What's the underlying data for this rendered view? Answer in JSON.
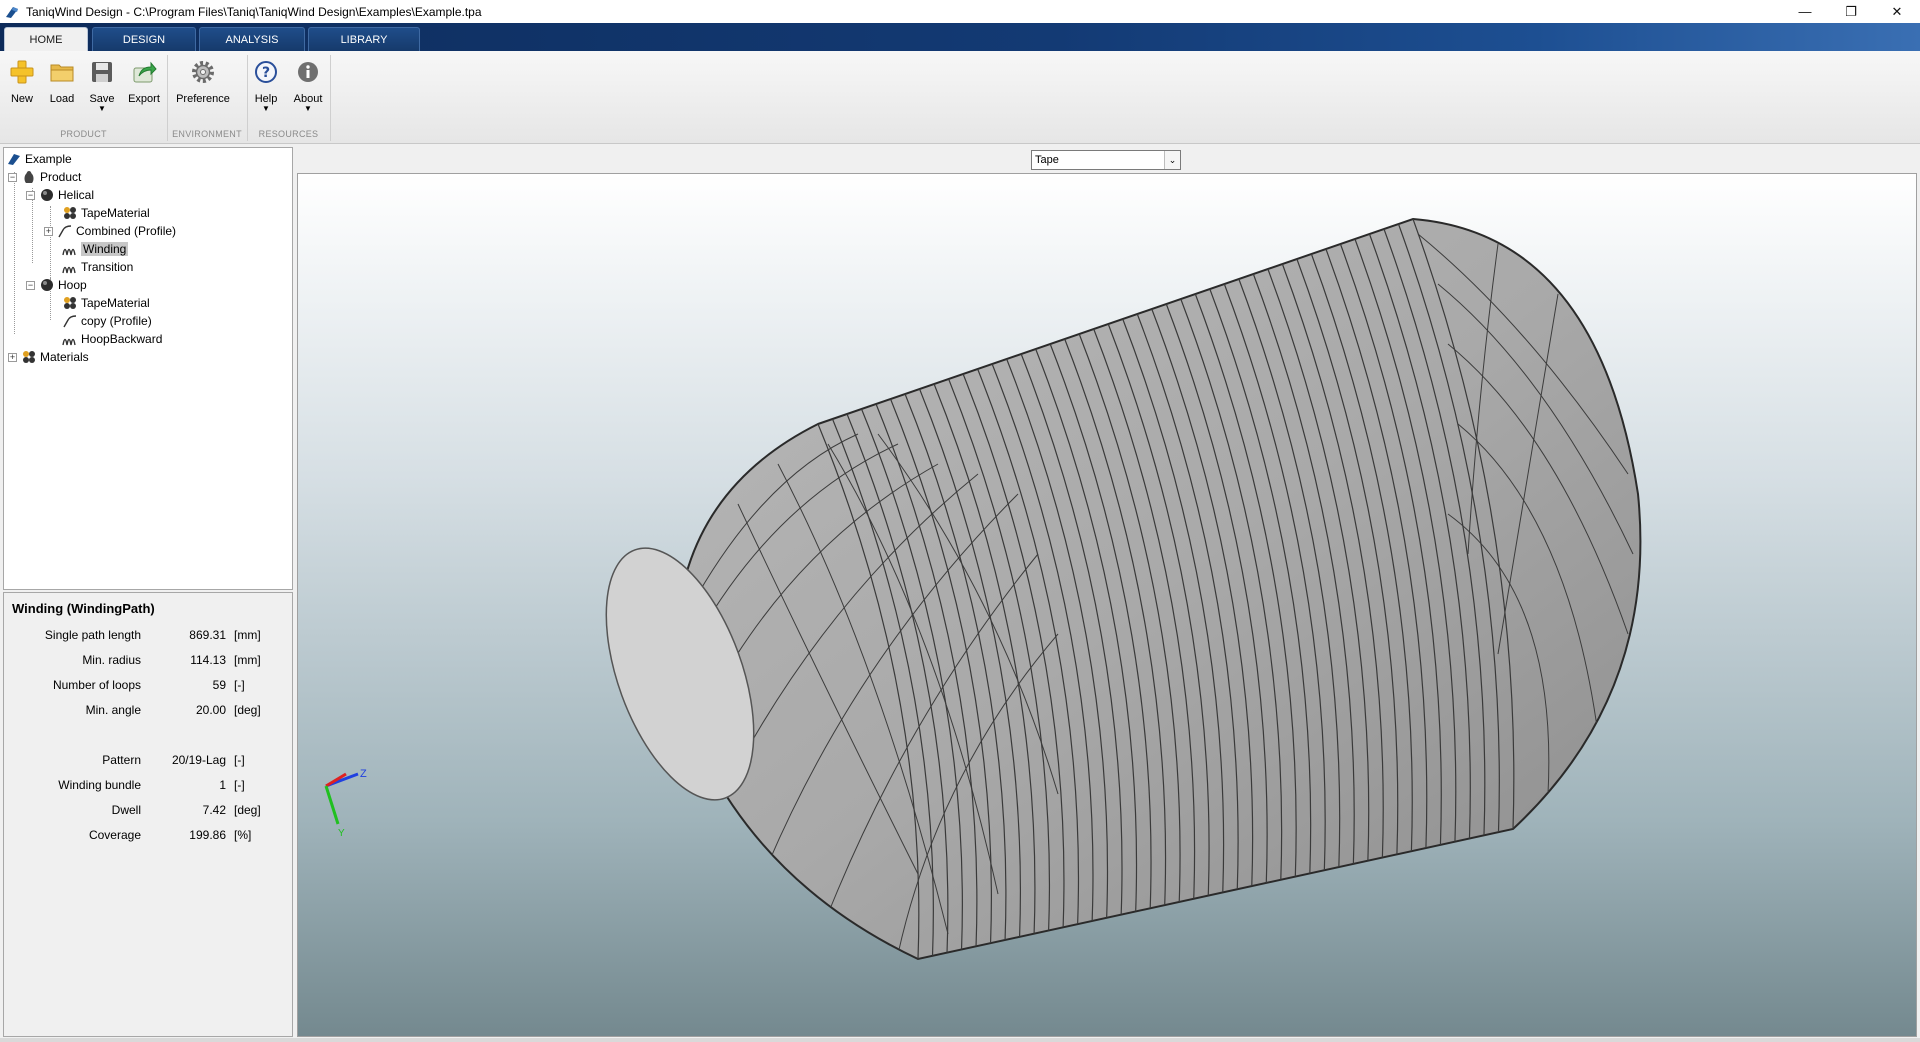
{
  "window": {
    "title": "TaniqWind Design - C:\\Program Files\\Taniq\\TaniqWind Design\\Examples\\Example.tpa",
    "controls": [
      "minimize",
      "restore",
      "close"
    ]
  },
  "tabs": [
    {
      "label": "HOME",
      "active": true
    },
    {
      "label": "DESIGN",
      "active": false
    },
    {
      "label": "ANALYSIS",
      "active": false
    },
    {
      "label": "LIBRARY",
      "active": false
    }
  ],
  "ribbon": {
    "buttons": {
      "new": "New",
      "load": "Load",
      "save": "Save",
      "export": "Export",
      "preference": "Preference",
      "help": "Help",
      "about": "About"
    },
    "groups": {
      "product": "PRODUCT",
      "environment": "ENVIRONMENT",
      "resources": "RESOURCES"
    }
  },
  "tree": {
    "root": "Example",
    "product": "Product",
    "helical": "Helical",
    "helical_tape": "TapeMaterial",
    "helical_profile": "Combined (Profile)",
    "helical_winding": "Winding",
    "helical_transition": "Transition",
    "hoop": "Hoop",
    "hoop_tape": "TapeMaterial",
    "hoop_profile": "copy (Profile)",
    "hoop_backward": "HoopBackward",
    "materials": "Materials",
    "selected": "Winding"
  },
  "properties": {
    "title": "Winding (WindingPath)",
    "rows": [
      {
        "label": "Single path length",
        "value": "869.31",
        "unit": "[mm]"
      },
      {
        "label": "Min. radius",
        "value": "114.13",
        "unit": "[mm]"
      },
      {
        "label": "Number of loops",
        "value": "59",
        "unit": "[-]"
      },
      {
        "label": "Min. angle",
        "value": "20.00",
        "unit": "[deg]"
      },
      {
        "label": "Pattern",
        "value": "20/19-Lag",
        "unit": "[-]"
      },
      {
        "label": "Winding bundle",
        "value": "1",
        "unit": "[-]"
      },
      {
        "label": "Dwell",
        "value": "7.42",
        "unit": "[deg]"
      },
      {
        "label": "Coverage",
        "value": "199.86",
        "unit": "[%]"
      }
    ]
  },
  "viewport": {
    "display_mode": "Tape",
    "axes": {
      "x": "X",
      "y": "Y",
      "z": "Z"
    }
  },
  "colors": {
    "tab_bar": "#133a74",
    "selection": "#c7c7c7",
    "axis_x": "#e02020",
    "axis_y": "#20c020",
    "axis_z": "#2040e0"
  }
}
